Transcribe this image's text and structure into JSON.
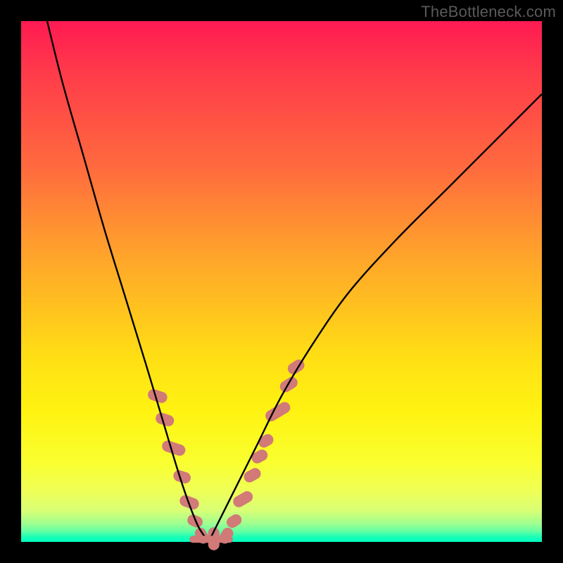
{
  "watermark": {
    "text": "TheBottleneck.com"
  },
  "colors": {
    "curve_stroke": "#000000",
    "marker_fill": "#d17a78",
    "marker_stroke": "#d17a78"
  },
  "chart_data": {
    "type": "line",
    "title": "",
    "xlabel": "",
    "ylabel": "",
    "xlim": [
      0,
      100
    ],
    "ylim": [
      0,
      100
    ],
    "curve_left": {
      "comment": "x goes 0..36, y from 100 down to 0",
      "x": [
        5,
        8,
        12,
        16,
        20,
        24,
        27,
        30,
        32,
        34,
        36
      ],
      "y": [
        100,
        88,
        74,
        60,
        47,
        34,
        24,
        14,
        8,
        3,
        0
      ]
    },
    "curve_right": {
      "comment": "x goes 36..100, y from 0 up to ~86",
      "x": [
        36,
        40,
        45,
        50,
        56,
        63,
        72,
        82,
        92,
        100
      ],
      "y": [
        0,
        8,
        18,
        28,
        38,
        48,
        58,
        68,
        78,
        86
      ]
    },
    "bottom_segment": {
      "comment": "short flat segment at vertex",
      "x": [
        33,
        40
      ],
      "y": [
        0.5,
        0.5
      ]
    },
    "markers": {
      "comment": "salmon rounded markers near the bottom of the V",
      "points": [
        {
          "x": 26.2,
          "y": 28,
          "len": 3.8,
          "angle": -72
        },
        {
          "x": 27.6,
          "y": 23.5,
          "len": 3.6,
          "angle": -72
        },
        {
          "x": 29.3,
          "y": 18.0,
          "len": 4.6,
          "angle": -72
        },
        {
          "x": 30.9,
          "y": 12.5,
          "len": 3.4,
          "angle": -72
        },
        {
          "x": 32.3,
          "y": 7.6,
          "len": 3.8,
          "angle": -70
        },
        {
          "x": 33.4,
          "y": 4.0,
          "len": 3.0,
          "angle": -66
        },
        {
          "x": 34.7,
          "y": 1.2,
          "len": 3.2,
          "angle": -30
        },
        {
          "x": 37.0,
          "y": 0.6,
          "len": 4.4,
          "angle": 0
        },
        {
          "x": 39.4,
          "y": 1.2,
          "len": 3.2,
          "angle": 30
        },
        {
          "x": 40.9,
          "y": 4.0,
          "len": 3.0,
          "angle": 58
        },
        {
          "x": 42.6,
          "y": 8.2,
          "len": 4.0,
          "angle": 60
        },
        {
          "x": 44.4,
          "y": 12.8,
          "len": 3.4,
          "angle": 61
        },
        {
          "x": 45.8,
          "y": 16.4,
          "len": 3.2,
          "angle": 61
        },
        {
          "x": 47.0,
          "y": 19.4,
          "len": 3.0,
          "angle": 60
        },
        {
          "x": 49.3,
          "y": 25.0,
          "len": 5.2,
          "angle": 59
        },
        {
          "x": 51.4,
          "y": 30.2,
          "len": 3.6,
          "angle": 58
        },
        {
          "x": 52.8,
          "y": 33.6,
          "len": 3.4,
          "angle": 57
        }
      ]
    }
  }
}
